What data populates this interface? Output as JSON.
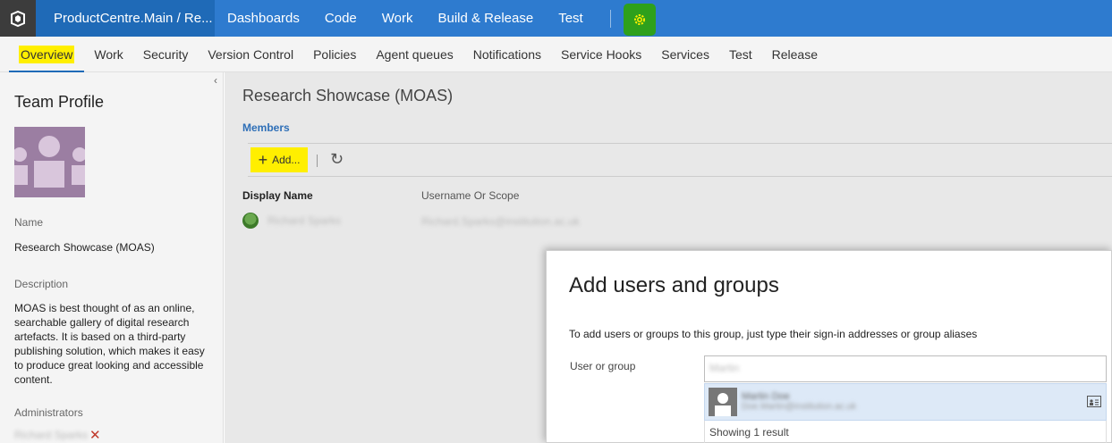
{
  "topbar": {
    "project": "ProductCentre.Main / Re...",
    "nav": [
      "Dashboards",
      "Code",
      "Work",
      "Build & Release",
      "Test"
    ],
    "colors": {
      "bar": "#2e7bcf",
      "project": "#1f6ab7",
      "highlight": "#2ea01c"
    }
  },
  "subnav": {
    "tabs": [
      "Overview",
      "Work",
      "Security",
      "Version Control",
      "Policies",
      "Agent queues",
      "Notifications",
      "Service Hooks",
      "Services",
      "Test",
      "Release"
    ],
    "active": "Overview"
  },
  "profile": {
    "heading": "Team Profile",
    "name_label": "Name",
    "name": "Research Showcase (MOAS)",
    "description_label": "Description",
    "description": "MOAS is best thought of as an online, searchable gallery of digital research artefacts. It is based on a third-party publishing solution, which makes it easy to produce great looking and accessible content.",
    "administrators_label": "Administrators",
    "administrator": "Richard Sparks"
  },
  "main": {
    "title": "Research Showcase (MOAS)",
    "members_label": "Members",
    "add_label": "Add...",
    "col_display": "Display Name",
    "col_user": "Username Or Scope",
    "member_name": "Richard Sparks",
    "member_user": "Richard.Sparks@institution.ac.uk"
  },
  "dialog": {
    "title": "Add users and groups",
    "hint": "To add users or groups to this group, just type their sign-in addresses or group aliases",
    "user_label": "User or group",
    "input_value": "Martin",
    "suggestion_name": "Martin Doe",
    "suggestion_email": "Doe.Martin@institution.ac.uk",
    "result_text": "Showing 1 result"
  }
}
